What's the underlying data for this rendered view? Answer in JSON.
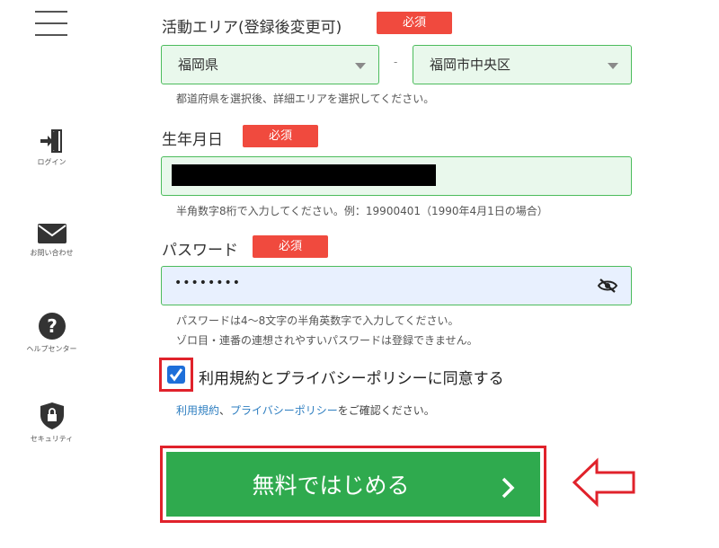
{
  "sidebar": {
    "items": [
      {
        "label": "ログイン",
        "icon": "login-icon"
      },
      {
        "label": "お問い合わせ",
        "icon": "mail-icon"
      },
      {
        "label": "ヘルプセンター",
        "icon": "help-icon"
      },
      {
        "label": "セキュリティ",
        "icon": "security-shield-icon"
      }
    ]
  },
  "area": {
    "label": "活動エリア(登録後変更可)",
    "required": "必須",
    "prefecture": "福岡県",
    "separator": "-",
    "city": "福岡市中央区",
    "hint": "都道府県を選択後、詳細エリアを選択してください。"
  },
  "birthdate": {
    "label": "生年月日",
    "required": "必須",
    "hint": "半角数字8桁で入力してください。例：19900401（1990年4月1日の場合）"
  },
  "password": {
    "label": "パスワード",
    "required": "必須",
    "value": "••••••••",
    "hint1": "パスワードは4〜8文字の半角英数字で入力してください。",
    "hint2": "ゾロ目・連番の連想されやすいパスワードは登録できません。"
  },
  "agree": {
    "label": "利用規約とプライバシーポリシーに同意する",
    "checked": true,
    "link_terms": "利用規約",
    "sep": "、",
    "link_privacy": "プライバシーポリシー",
    "suffix": "をご確認ください。"
  },
  "cta": {
    "label": "無料ではじめる"
  },
  "colors": {
    "accent_green": "#2faa4e",
    "required_red": "#f04a3e",
    "highlight_red": "#e0222b",
    "checkbox_blue": "#1e6fd9",
    "link_blue": "#2f7fc1"
  }
}
